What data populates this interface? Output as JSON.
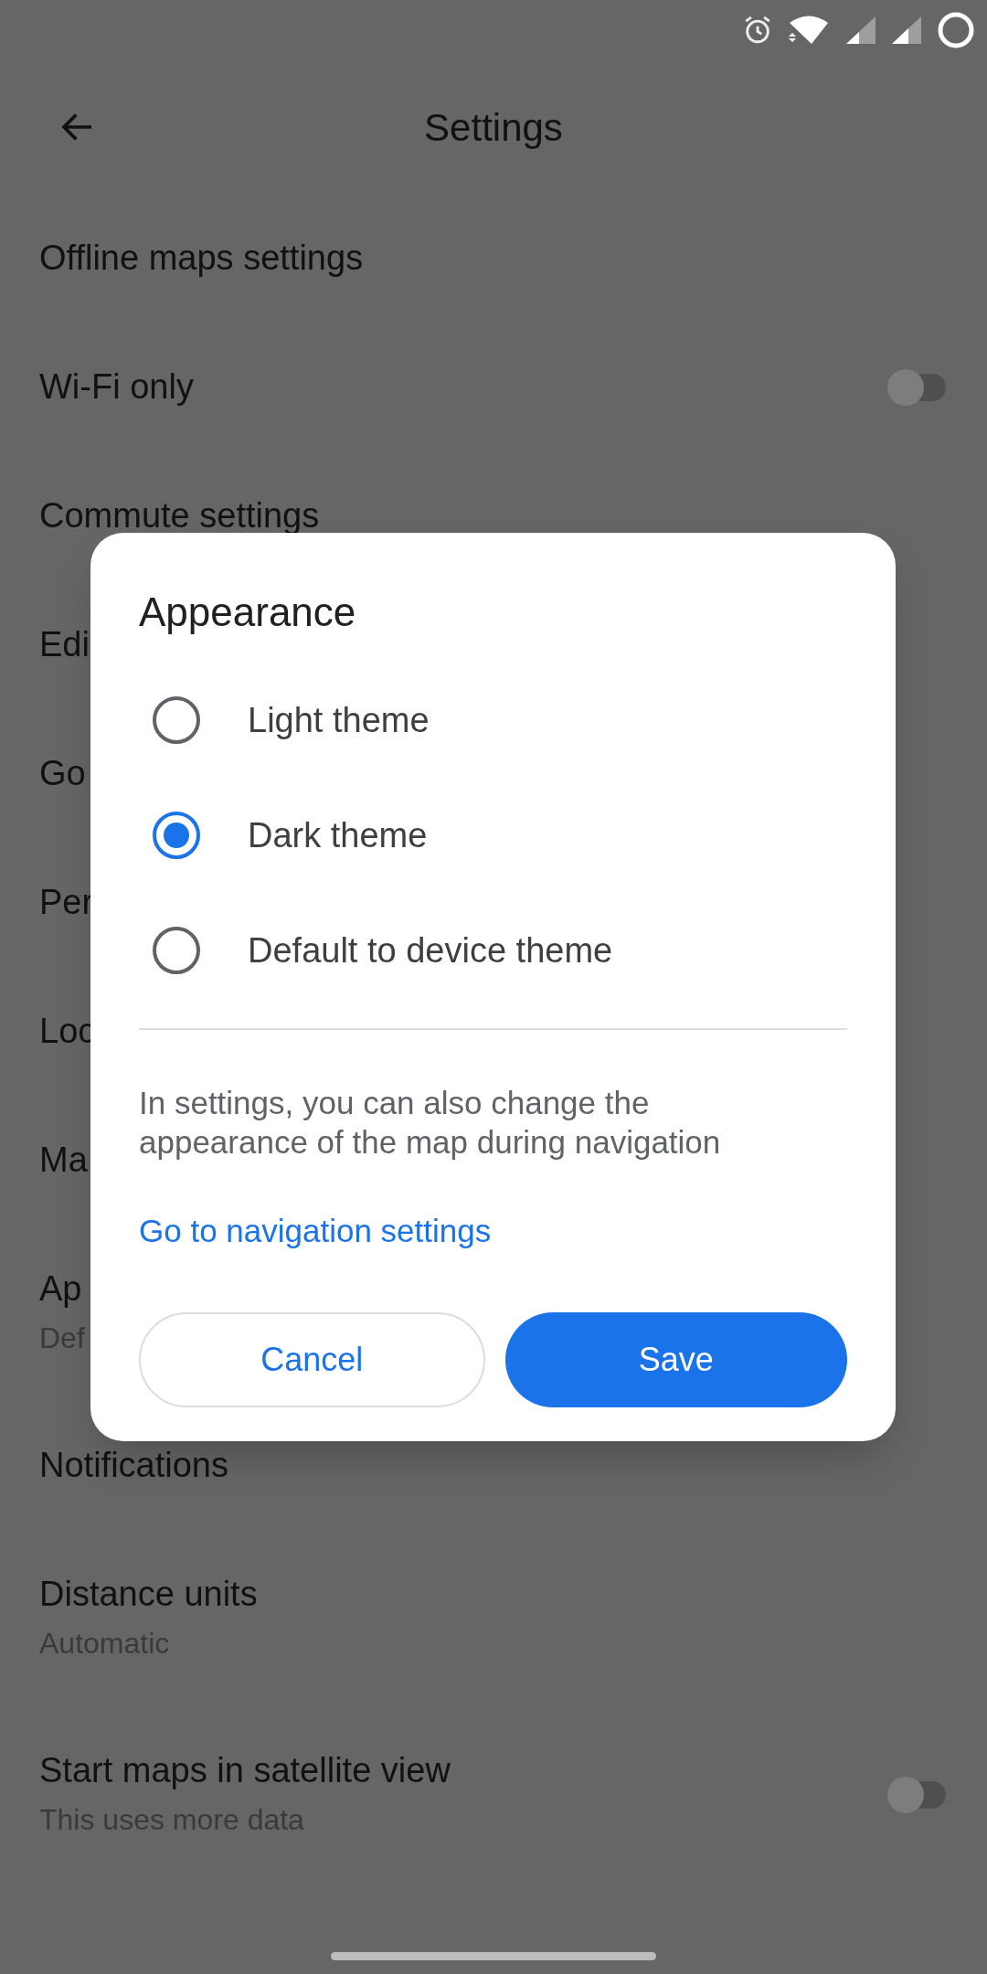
{
  "header": {
    "title": "Settings"
  },
  "settings_items": [
    {
      "kind": "plain",
      "title": "Offline maps settings"
    },
    {
      "kind": "toggle",
      "title": "Wi-Fi only",
      "on": false
    },
    {
      "kind": "plain",
      "title": "Commute settings"
    },
    {
      "kind": "plain",
      "title": "Edi"
    },
    {
      "kind": "plain",
      "title": "Go"
    },
    {
      "kind": "plain",
      "title": "Per"
    },
    {
      "kind": "plain",
      "title": "Loc"
    },
    {
      "kind": "plain",
      "title": "Ma"
    },
    {
      "kind": "plain",
      "title": "Ap",
      "subtitle": "Def"
    },
    {
      "kind": "plain",
      "title": "Notifications"
    },
    {
      "kind": "plain",
      "title": "Distance units",
      "subtitle": "Automatic"
    },
    {
      "kind": "toggle",
      "title": "Start maps in satellite view",
      "subtitle": "This uses more data",
      "on": false
    }
  ],
  "dialog": {
    "title": "Appearance",
    "options": [
      {
        "label": "Light theme",
        "selected": false
      },
      {
        "label": "Dark theme",
        "selected": true
      },
      {
        "label": "Default to device theme",
        "selected": false
      }
    ],
    "note": "In settings, you can also change the appearance of the map during navigation",
    "link": "Go to navigation settings",
    "buttons": [
      {
        "label": "Cancel",
        "kind": "secondary"
      },
      {
        "label": "Save",
        "kind": "primary"
      }
    ]
  }
}
